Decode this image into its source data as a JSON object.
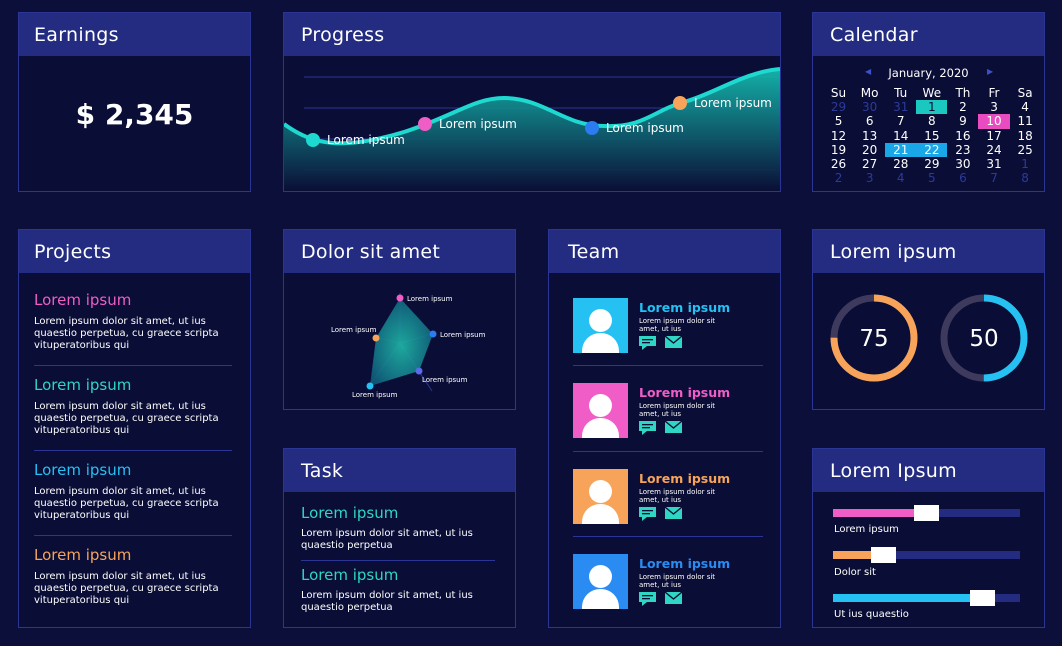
{
  "colors": {
    "background": "#0b0f3a",
    "panel": "#0a0d35",
    "header": "#232c80",
    "teal": "#2fd6c4",
    "pink": "#f05dc6",
    "blue": "#2a7cf0",
    "cyan": "#24c1f2",
    "orange": "#f7a45a"
  },
  "earnings": {
    "title": "Earnings",
    "value": "$ 2,345"
  },
  "progress": {
    "title": "Progress",
    "points": [
      {
        "label": "Lorem ipsum",
        "color": "#1ed9d0"
      },
      {
        "label": "Lorem ipsum",
        "color": "#f05dc6"
      },
      {
        "label": "Lorem ipsum",
        "color": "#2a7cf0"
      },
      {
        "label": "Lorem ipsum",
        "color": "#f7a45a"
      }
    ]
  },
  "calendar": {
    "title": "Calendar",
    "month": "January, 2020",
    "prev_icon": "chevron-left-icon",
    "next_icon": "chevron-right-icon",
    "weekdays": [
      "Su",
      "Mo",
      "Tu",
      "We",
      "Th",
      "Fr",
      "Sa"
    ],
    "days": [
      "29",
      "30",
      "31",
      "1",
      "2",
      "3",
      "4",
      "5",
      "6",
      "7",
      "8",
      "9",
      "10",
      "11",
      "12",
      "13",
      "14",
      "15",
      "16",
      "17",
      "18",
      "19",
      "20",
      "21",
      "22",
      "23",
      "24",
      "25",
      "26",
      "27",
      "28",
      "29",
      "30",
      "31",
      "1",
      "2",
      "3",
      "4",
      "5",
      "6",
      "7",
      "8"
    ],
    "muted_indices": [
      0,
      1,
      2,
      34,
      35,
      36,
      37,
      38,
      39,
      40,
      41
    ],
    "highlighted": {
      "1": "teal",
      "10": "pink",
      "21": "cyan",
      "22": "cyan"
    }
  },
  "projects": {
    "title": "Projects",
    "items": [
      {
        "title": "Lorem ipsum",
        "color": "#f05dc6",
        "text": "Lorem ipsum dolor sit amet, ut ius quaestio perpetua, cu graece scripta vituperatoribus qui"
      },
      {
        "title": "Lorem ipsum",
        "color": "#2fd6c4",
        "text": "Lorem ipsum dolor sit amet, ut ius quaestio perpetua, cu graece scripta vituperatoribus qui"
      },
      {
        "title": "Lorem ipsum",
        "color": "#24c1f2",
        "text": "Lorem ipsum dolor sit amet, ut ius quaestio perpetua, cu graece scripta vituperatoribus qui"
      },
      {
        "title": "Lorem ipsum",
        "color": "#f7a45a",
        "text": "Lorem ipsum dolor sit amet, ut ius quaestio perpetua, cu graece scripta vituperatoribus qui"
      }
    ]
  },
  "radar": {
    "title": "Dolor sit amet",
    "points": [
      {
        "label": "Lorem ipsum",
        "color": "#f05dc6"
      },
      {
        "label": "Lorem ipsum",
        "color": "#2a7cf0"
      },
      {
        "label": "Lorem ipsum",
        "color": "#5a6be8"
      },
      {
        "label": "Lorem ipsum",
        "color": "#24c1f2"
      },
      {
        "label": "Lorem ipsum",
        "color": "#f7a45a"
      }
    ]
  },
  "task": {
    "title": "Task",
    "items": [
      {
        "title": "Lorem ipsum",
        "text": "Lorem ipsum dolor sit amet, ut ius quaestio perpetua"
      },
      {
        "title": "Lorem ipsum",
        "text": "Lorem ipsum dolor sit amet, ut ius quaestio perpetua"
      }
    ]
  },
  "team": {
    "title": "Team",
    "members": [
      {
        "name": "Lorem ipsum",
        "color": "#24c1f2",
        "text": "Lorem ipsum dolor sit amet, ut ius"
      },
      {
        "name": "Lorem ipsum",
        "color": "#f05dc6",
        "text": "Lorem ipsum dolor sit amet, ut ius"
      },
      {
        "name": "Lorem ipsum",
        "color": "#f7a45a",
        "text": "Lorem ipsum dolor sit amet, ut ius"
      },
      {
        "name": "Lorem ipsum",
        "color": "#2a8cf2",
        "text": "Lorem ipsum dolor sit amet, ut ius"
      }
    ]
  },
  "gauges": {
    "title": "Lorem ipsum",
    "items": [
      {
        "value": "75",
        "percent": 75,
        "color": "#f7a45a"
      },
      {
        "value": "50",
        "percent": 50,
        "color": "#24c1f2"
      }
    ]
  },
  "sliders": {
    "title": "Lorem Ipsum",
    "items": [
      {
        "label": "Lorem ipsum",
        "level": 0.5,
        "color": "#f05dc6"
      },
      {
        "label": "Dolor sit",
        "level": 0.27,
        "color": "#f7a45a"
      },
      {
        "label": "Ut ius quaestio",
        "level": 0.8,
        "color": "#24c1f2"
      }
    ]
  }
}
